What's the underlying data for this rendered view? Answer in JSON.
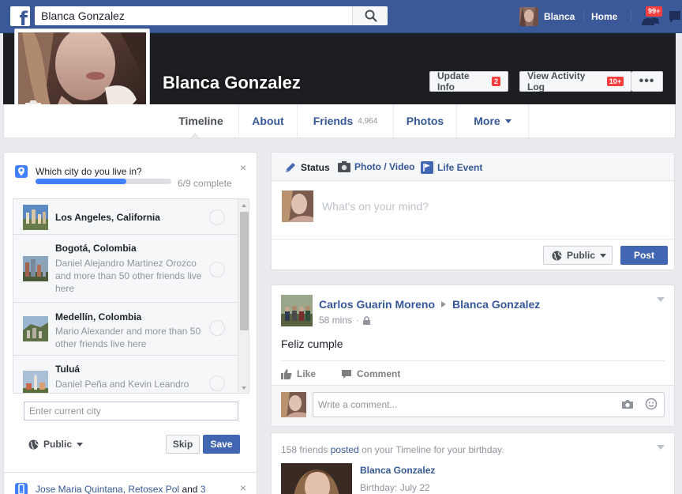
{
  "topbar": {
    "logo": "f",
    "search_value": "Blanca Gonzalez",
    "user_name": "Blanca",
    "home_label": "Home",
    "friend_requests_badge": "99+"
  },
  "profile": {
    "name": "Blanca Gonzalez",
    "update_info_label": "Update Info",
    "update_info_count": "2",
    "activity_log_label": "View Activity Log",
    "activity_log_count": "10+",
    "more_dots": "•••"
  },
  "tabs": [
    {
      "label": "Timeline"
    },
    {
      "label": "About"
    },
    {
      "label": "Friends",
      "count": "4,964"
    },
    {
      "label": "Photos"
    },
    {
      "label": "More"
    }
  ],
  "question_card": {
    "question": "Which city do you live in?",
    "close": "×",
    "progress_text": "6/9 complete",
    "progress_fraction": 0.667,
    "cities": [
      {
        "name": "Los Angeles, California",
        "detail": ""
      },
      {
        "name": "Bogotá, Colombia",
        "detail": "Daniel Alejandro Martinez Orozco and more than 50 other friends live here"
      },
      {
        "name": "Medellín, Colombia",
        "detail": "Mario Alexander and more than 50 other friends live here"
      },
      {
        "name": "Tuluá",
        "detail": "Daniel Peña and Kevin Leandro Zapata Quiceliz live here"
      }
    ],
    "city_input_placeholder": "Enter current city",
    "privacy_label": "Public",
    "skip_label": "Skip",
    "save_label": "Save"
  },
  "suggestion_card": {
    "names": "Jose Maria Quintana, Retosex Pol",
    "connector": "and",
    "more": "3",
    "close": "×"
  },
  "composer": {
    "tabs": [
      {
        "label": "Status"
      },
      {
        "label": "Photo / Video"
      },
      {
        "label": "Life Event"
      }
    ],
    "placeholder": "What's on your mind?",
    "privacy_label": "Public",
    "post_label": "Post"
  },
  "post": {
    "author": "Carlos Guarin Moreno",
    "target": "Blanca Gonzalez",
    "time": "58 mins",
    "separator": "·",
    "body": "Feliz cumple",
    "like_label": "Like",
    "comment_label": "Comment",
    "comment_placeholder": "Write a comment..."
  },
  "birthday": {
    "count_text": "158 friends",
    "posted_word": "posted",
    "rest_text": "on your Timeline for your birthday.",
    "name": "Blanca Gonzalez",
    "date": "Birthday: July 22"
  },
  "colors": {
    "brand": "#3b5998",
    "link": "#365899",
    "primary_button": "#4267b2",
    "progress": "#4080ff",
    "alert": "#fa3e3e"
  }
}
